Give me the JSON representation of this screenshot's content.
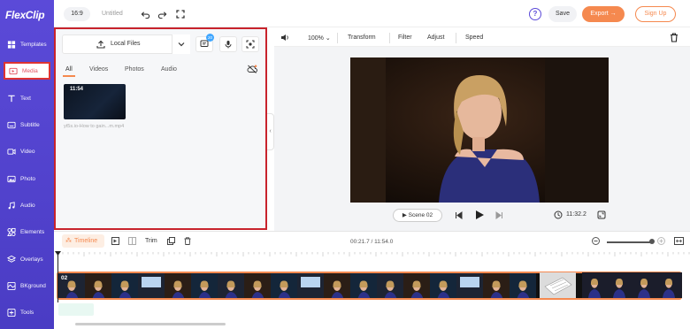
{
  "app": {
    "logo": "FlexClip"
  },
  "sidebar": {
    "items": [
      {
        "label": "Templates",
        "icon": "templates-icon"
      },
      {
        "label": "Media",
        "icon": "media-icon",
        "active": true
      },
      {
        "label": "Text",
        "icon": "text-icon"
      },
      {
        "label": "Subtitle",
        "icon": "subtitle-icon"
      },
      {
        "label": "Video",
        "icon": "video-icon"
      },
      {
        "label": "Photo",
        "icon": "photo-icon"
      },
      {
        "label": "Audio",
        "icon": "audio-icon"
      },
      {
        "label": "Elements",
        "icon": "elements-icon"
      },
      {
        "label": "Overlays",
        "icon": "overlays-icon"
      },
      {
        "label": "BKground",
        "icon": "background-icon"
      },
      {
        "label": "Tools",
        "icon": "tools-icon"
      }
    ]
  },
  "topbar": {
    "ratio": "16:9",
    "title": "Untitled",
    "help": "?",
    "save": "Save",
    "export": "Export →",
    "signup": "Sign Up"
  },
  "media_panel": {
    "upload_label": "Local Files",
    "badge": "20",
    "tabs": [
      "All",
      "Videos",
      "Photos",
      "Audio"
    ],
    "active_tab": "All",
    "item": {
      "duration": "11:54",
      "filename": "yt5s.io-How to gain...m.mp4"
    }
  },
  "editor": {
    "zoom": "100%",
    "tools": [
      "Transform",
      "Filter",
      "Adjust",
      "Speed"
    ],
    "scene_label": "Scene 02",
    "total_time": "11:32.2"
  },
  "timeline": {
    "label": "Timeline",
    "trim": "Trim",
    "position": "00:21.7 / 11:54.0",
    "clip_number": "02",
    "zoom_level": 0.93
  },
  "colors": {
    "brand": "#5b4ad8",
    "accent": "#f5894f",
    "highlight": "#c8232c"
  }
}
